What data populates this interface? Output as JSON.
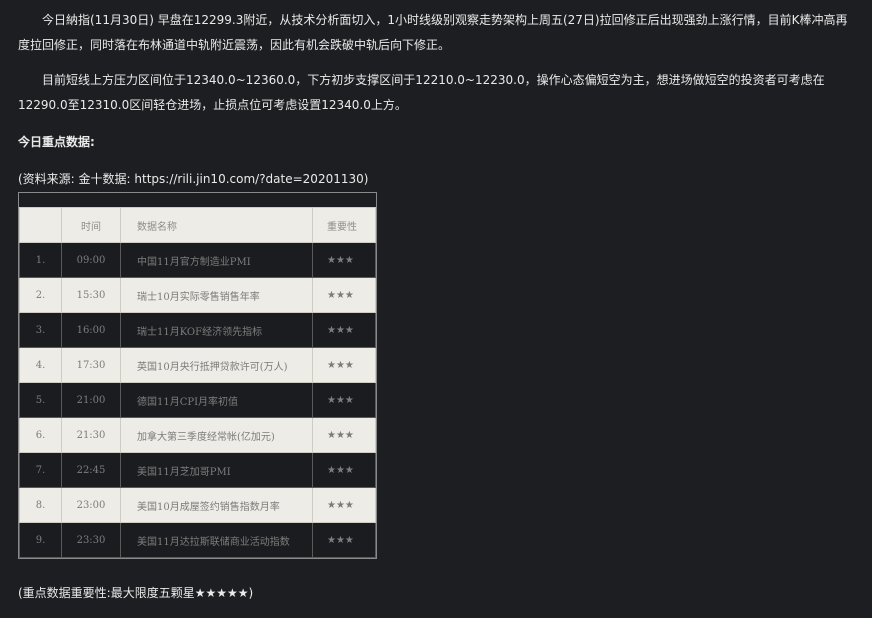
{
  "paragraphs": [
    "今日納指(11月30日) 早盘在12299.3附近，从技术分析面切入，1小时线级别观察走势架构上周五(27日)拉回修正后出现强劲上涨行情，目前K棒冲高再度拉回修正，同时落在布林通道中轨附近震荡，因此有机会跌破中轨后向下修正。",
    "目前短线上方压力区间位于12340.0~12360.0，下方初步支撑区间于12210.0~12230.0，操作心态偏短空为主，想进场做短空的投资者可考虑在12290.0至12310.0区间轻仓进场，止损点位可考虑设置12340.0上方。"
  ],
  "section_heading": "今日重点数据:",
  "source_line": "(资料来源: 金十数据: https://rili.jin10.com/?date=20201130)",
  "table": {
    "headers": [
      "",
      "时间",
      "数据名称",
      "重要性"
    ],
    "rows": [
      {
        "no": "1.",
        "time": "09:00",
        "name": "中国11月官方制造业PMI",
        "importance": "★★★"
      },
      {
        "no": "2.",
        "time": "15:30",
        "name": "瑞士10月实际零售销售年率",
        "importance": "★★★"
      },
      {
        "no": "3.",
        "time": "16:00",
        "name": "瑞士11月KOF经济领先指标",
        "importance": "★★★"
      },
      {
        "no": "4.",
        "time": "17:30",
        "name": "英国10月央行抵押贷款许可(万人)",
        "importance": "★★★"
      },
      {
        "no": "5.",
        "time": "21:00",
        "name": "德国11月CPI月率初值",
        "importance": "★★★"
      },
      {
        "no": "6.",
        "time": "21:30",
        "name": "加拿大第三季度经常帐(亿加元)",
        "importance": "★★★"
      },
      {
        "no": "7.",
        "time": "22:45",
        "name": "美国11月芝加哥PMI",
        "importance": "★★★"
      },
      {
        "no": "8.",
        "time": "23:00",
        "name": "美国10月成屋签约销售指数月率",
        "importance": "★★★"
      },
      {
        "no": "9.",
        "time": "23:30",
        "name": "美国11月达拉斯联储商业活动指数",
        "importance": "★★★"
      }
    ]
  },
  "footnote": "(重点数据重要性:最大限度五颗星★★★★★)"
}
